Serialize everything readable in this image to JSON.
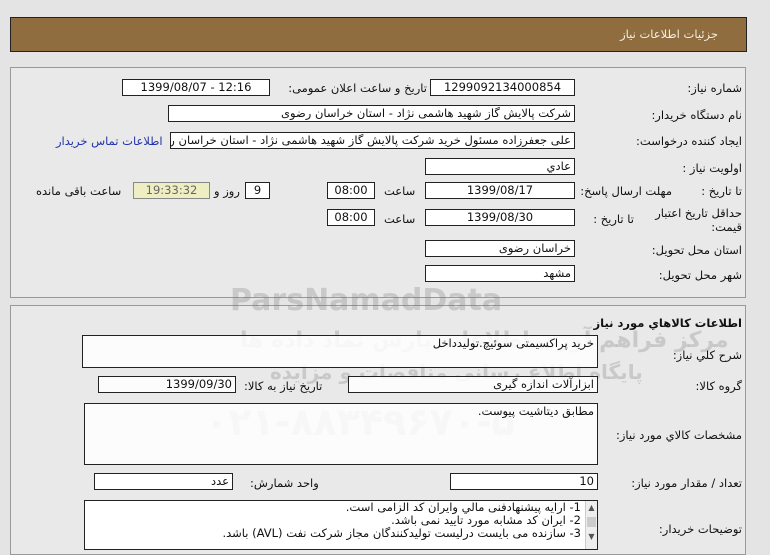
{
  "header": {
    "title": "جزئیات اطلاعات نیاز"
  },
  "watermark": {
    "brand": "ParsNamadData",
    "line1": "مرکز فراهم آوری اطلاعات پارس نماد داده ها",
    "line2": "پایگاه اطلاع رسانی مناقصات و مزایده",
    "phone": "۰۲۱-۸۸۳۴۹۶۷۰-۵"
  },
  "details": {
    "need_number_label": "شماره نیاز:",
    "need_number": "1299092134000854",
    "announce_label": "تاریخ و ساعت اعلان عمومی:",
    "announce_value": "1399/08/07 - 12:16",
    "buyer_label": "نام دستگاه خریدار:",
    "buyer": "شرکت پالایش گاز شهید هاشمی نژاد - استان خراسان رضوی",
    "creator_label": "ایجاد کننده درخواست:",
    "creator": "علی جعفرزاده مسئول خرید شرکت پالایش گاز شهید هاشمی نژاد - استان خراسان رضوی",
    "contact_link": "اطلاعات تماس خریدار",
    "priority_label": "اولویت نیاز :",
    "priority": "عادي",
    "deadline_label": "مهلت ارسال پاسخ:",
    "to_date_label": "تا تاریخ :",
    "deadline_date": "1399/08/17",
    "time_label": "ساعت",
    "deadline_time": "08:00",
    "days": "9",
    "days_label": "روز و",
    "remaining": "19:33:32",
    "remaining_label": "ساعت باقی مانده",
    "validity_label": "حداقل تاریخ اعتبار قیمت:",
    "validity_date": "1399/08/30",
    "validity_time": "08:00",
    "province_label": "استان محل تحویل:",
    "province": "خراسان رضوی",
    "city_label": "شهر محل تحویل:",
    "city": "مشهد"
  },
  "goods": {
    "title": "اطلاعات کالاهاي مورد نياز",
    "summary_label": "شرح کلي نياز:",
    "summary": "خرید پراکسیمتی سوئیچ.تولیدداخل",
    "group_label": "گروه کالا:",
    "group": "ابزارآلات اندازه گیری",
    "need_date_label": "تاریخ نیاز به کالا:",
    "need_date": "1399/09/30",
    "specs_label": "مشخصات کالاي مورد نياز:",
    "specs": "مطابق دیتاشیت پیوست.",
    "qty_label": "تعداد / مقدار مورد نیاز:",
    "qty": "10",
    "unit_label": "واحد شمارش:",
    "unit": "عدد",
    "notes_label": "توضیحات خریدار:",
    "notes": [
      "1- ارایه پیشنهادفنی مالي وایران کد الزامی است.",
      "2- ایران کد مشابه مورد تایید نمی باشد.",
      "3- سازنده می بایست درلیست تولیدکنندگان مجاز شرکت نفت (AVL)  باشد."
    ]
  }
}
